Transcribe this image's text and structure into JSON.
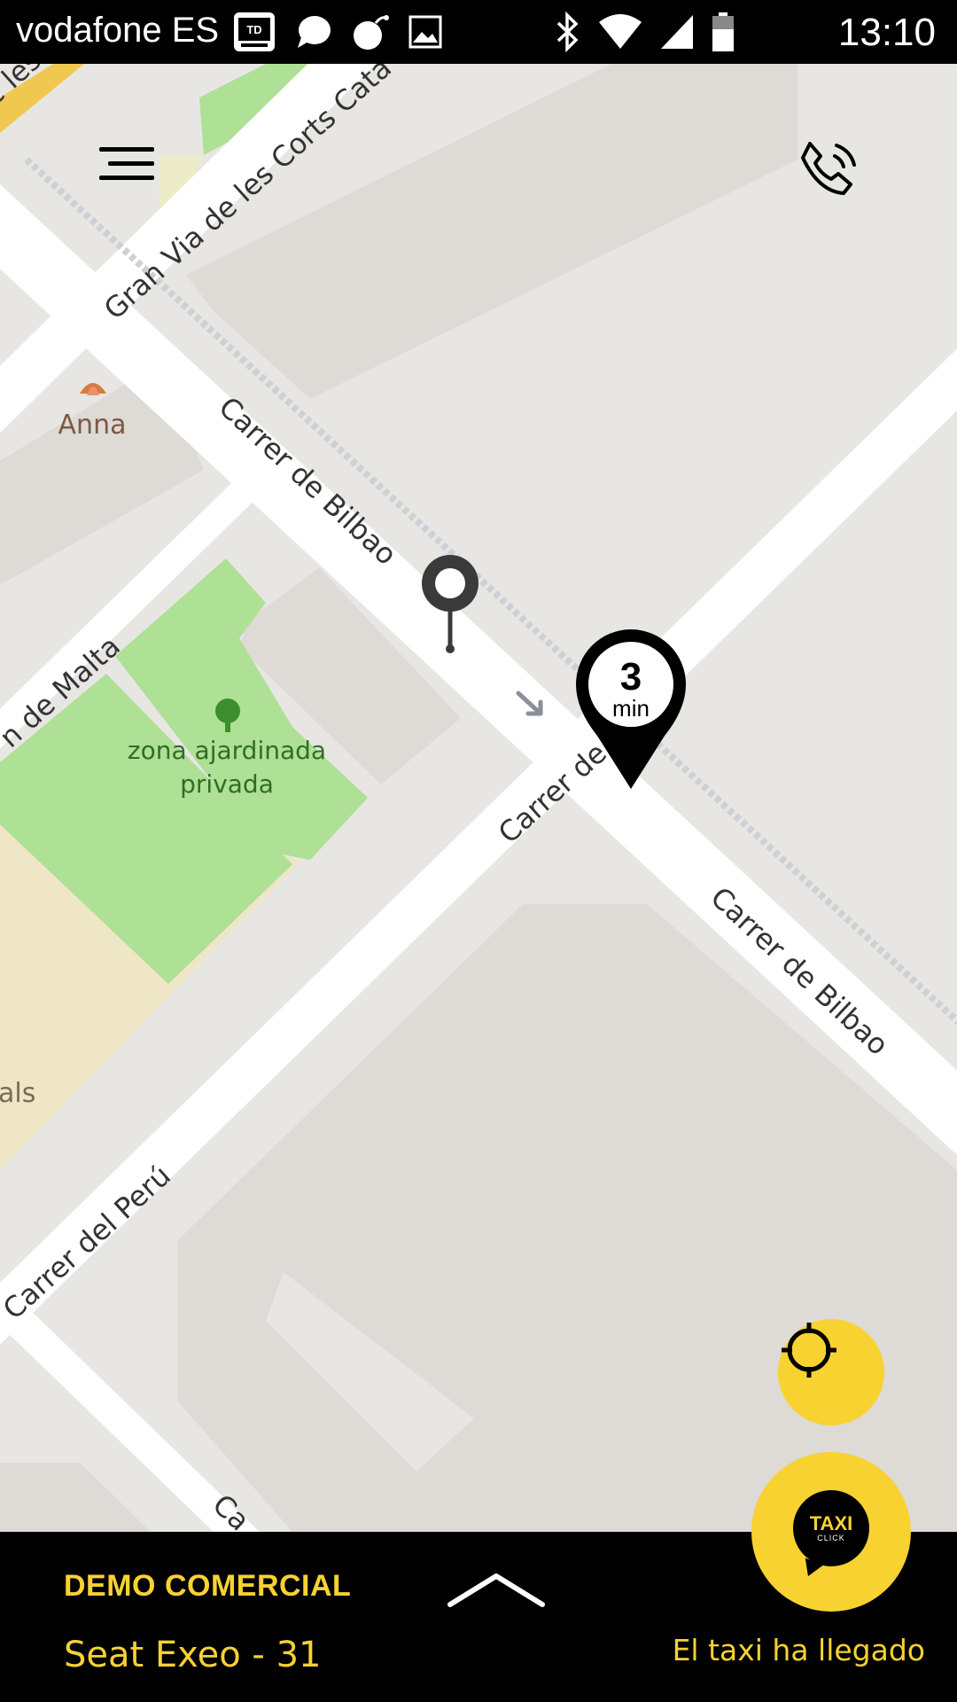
{
  "status_bar": {
    "carrier": "vodafone ES",
    "time": "13:10",
    "left_icons": [
      "td-app-icon",
      "chat-bubble-icon",
      "bomb-icon",
      "image-icon"
    ],
    "right_icons": [
      "bluetooth-icon",
      "wifi-icon",
      "cell-signal-icon",
      "battery-icon"
    ]
  },
  "map": {
    "labels": {
      "gran_via": "Gran Via de les Corts Cata",
      "bilbao_1": "Carrer de Bilbao",
      "bilbao_2": "Carrer de Bilbao",
      "malta": "n de Malta",
      "carrer_de": "Carrer de",
      "peru": "Carrer del Perú",
      "anna": "Anna",
      "park_line1": "zona ajardinada",
      "park_line2": "privada",
      "als": "als",
      "top_corner": "c les",
      "bottom_ca": "Ca"
    },
    "eta_marker": {
      "number": "3",
      "unit": "min"
    }
  },
  "bottom_bar": {
    "company": "DEMO COMERCIAL",
    "vehicle": "Seat Exeo - 31",
    "status": "El taxi ha llegado",
    "fab_logo_top": "TAXI",
    "fab_logo_bottom": "CLICK"
  },
  "colors": {
    "accent": "#f8d231",
    "map_background": "#e8e6e3",
    "park": "#aee096",
    "road": "#ffffff",
    "bar": "#000000"
  }
}
